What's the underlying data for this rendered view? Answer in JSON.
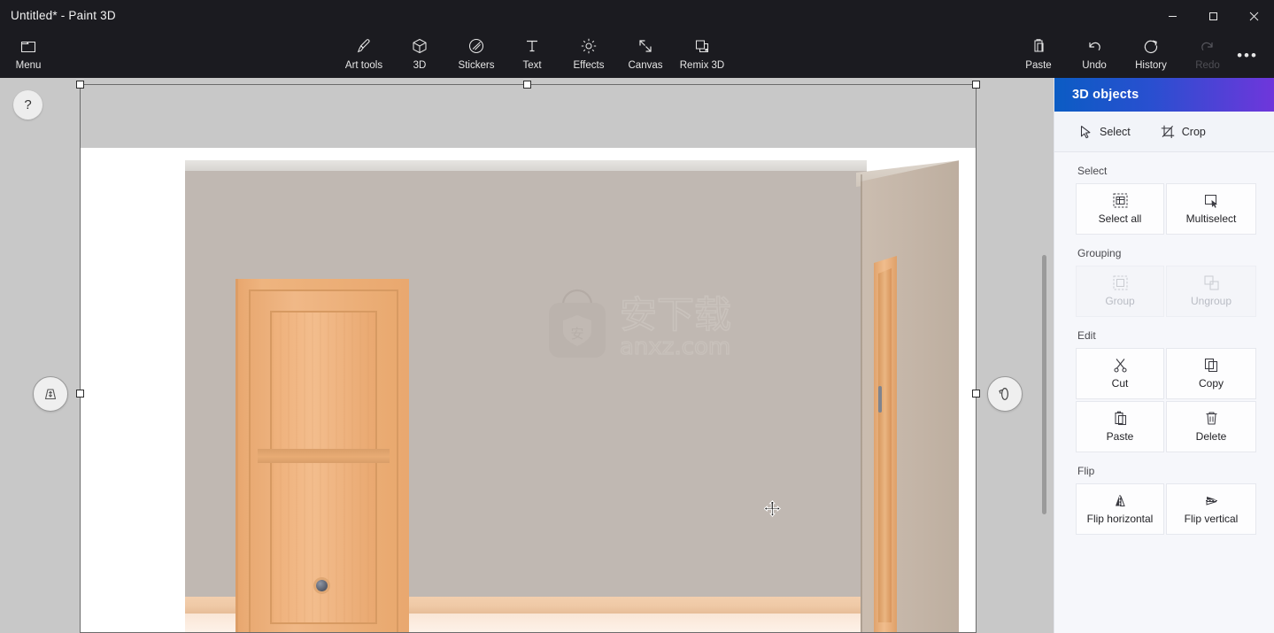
{
  "window": {
    "title": "Untitled* - Paint 3D",
    "controls": [
      {
        "name": "minimize",
        "label": "–"
      },
      {
        "name": "restore",
        "label": "❐"
      },
      {
        "name": "close",
        "label": "×"
      }
    ]
  },
  "ribbon": {
    "menu": {
      "label": "Menu",
      "icon": "folder-icon"
    },
    "tools": [
      {
        "label": "Art tools",
        "icon": "brush-icon",
        "disabled": false
      },
      {
        "label": "3D",
        "icon": "cube-icon",
        "disabled": false
      },
      {
        "label": "Stickers",
        "icon": "sticker-icon",
        "disabled": false
      },
      {
        "label": "Text",
        "icon": "text-icon",
        "disabled": false
      },
      {
        "label": "Effects",
        "icon": "effects-icon",
        "disabled": false
      },
      {
        "label": "Canvas",
        "icon": "canvas-icon",
        "disabled": false
      },
      {
        "label": "Remix 3D",
        "icon": "remix3d-icon",
        "disabled": false
      }
    ],
    "right_tools": [
      {
        "label": "Paste",
        "icon": "paste-icon",
        "disabled": false
      },
      {
        "label": "Undo",
        "icon": "undo-icon",
        "disabled": false
      },
      {
        "label": "History",
        "icon": "history-icon",
        "disabled": false
      },
      {
        "label": "Redo",
        "icon": "redo-icon",
        "disabled": true
      }
    ],
    "overflow": {
      "label": "•••",
      "icon": "more-icon"
    }
  },
  "canvas": {
    "help_label": "?",
    "watermark_text": "anxz.com",
    "watermark_cjk": "安下载",
    "perspective_handle": "perspective-icon",
    "rotate_handle": "rotate-icon",
    "cursor": "move-cursor"
  },
  "panel": {
    "title": "3D objects",
    "tabs": [
      {
        "label": "Select",
        "icon": "pointer-icon"
      },
      {
        "label": "Crop",
        "icon": "crop-icon"
      }
    ],
    "sections": [
      {
        "label": "Select",
        "items": [
          {
            "label": "Select all",
            "icon": "select-all-icon",
            "disabled": false
          },
          {
            "label": "Multiselect",
            "icon": "multiselect-icon",
            "disabled": false
          }
        ]
      },
      {
        "label": "Grouping",
        "items": [
          {
            "label": "Group",
            "icon": "group-icon",
            "disabled": true
          },
          {
            "label": "Ungroup",
            "icon": "ungroup-icon",
            "disabled": true
          }
        ]
      },
      {
        "label": "Edit",
        "items": [
          {
            "label": "Cut",
            "icon": "scissors-icon",
            "disabled": false
          },
          {
            "label": "Copy",
            "icon": "copy-icon",
            "disabled": false
          },
          {
            "label": "Paste",
            "icon": "paste-icon",
            "disabled": false
          },
          {
            "label": "Delete",
            "icon": "trash-icon",
            "disabled": false
          }
        ]
      },
      {
        "label": "Flip",
        "items": [
          {
            "label": "Flip horizontal",
            "icon": "flip-horizontal-icon",
            "disabled": false
          },
          {
            "label": "Flip vertical",
            "icon": "flip-vertical-icon",
            "disabled": false
          }
        ]
      }
    ]
  },
  "colors": {
    "titlebar_bg": "#1b1b20",
    "panel_header_start": "#0b5cc4",
    "panel_header_end": "#6f36db",
    "workspace_bg": "#c8c8c8",
    "wall": "#c0b8b2",
    "door_wood": "#eeb07a"
  }
}
